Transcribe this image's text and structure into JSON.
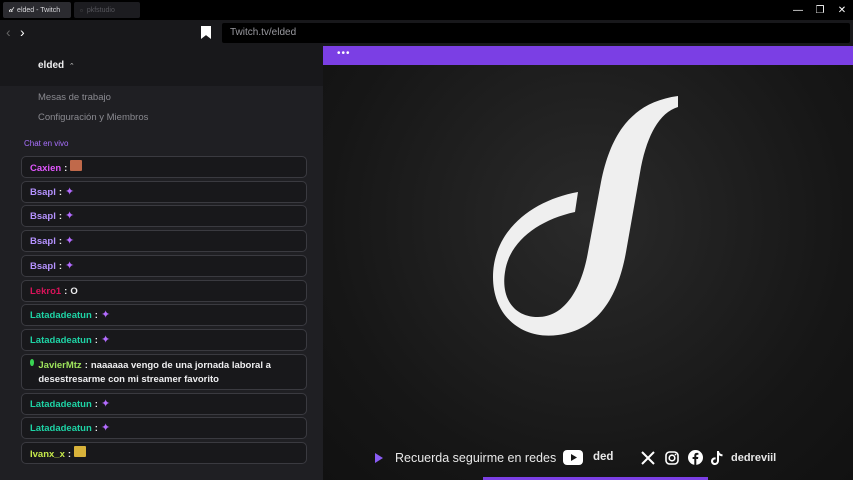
{
  "window": {
    "tabs": [
      {
        "label": "elded - Twitch",
        "active": true
      },
      {
        "label": "pkfstudio",
        "active": false
      }
    ],
    "controls": {
      "minimize": "—",
      "restore": "❐",
      "close": "✕"
    }
  },
  "nav": {
    "back": "‹",
    "forward": "›",
    "url": "Twitch.tv/elded"
  },
  "sidebar": {
    "channel": "elded",
    "channel_chevron": "⌃",
    "menu": [
      "Mesas de trabajo",
      "Configuración y Miembros"
    ],
    "section_label": "Chat en vivo"
  },
  "chat": [
    {
      "user": "Caxien",
      "color": "#e056fd",
      "text": "",
      "emote": "image-emote"
    },
    {
      "user": "Bsapl",
      "color": "#b592ff",
      "text": "",
      "emote": "purple-emote"
    },
    {
      "user": "Bsapl",
      "color": "#b592ff",
      "text": "",
      "emote": "purple-emote"
    },
    {
      "user": "Bsapl",
      "color": "#b592ff",
      "text": "",
      "emote": "purple-emote"
    },
    {
      "user": "Bsapl",
      "color": "#b592ff",
      "text": "",
      "emote": "purple-emote"
    },
    {
      "user": "Lekro1",
      "color": "#d9135a",
      "text": "O",
      "emote": ""
    },
    {
      "user": "Latadadeatun",
      "color": "#1ed3a5",
      "text": "",
      "emote": "purple-emote"
    },
    {
      "user": "Latadadeatun",
      "color": "#1ed3a5",
      "text": "",
      "emote": "purple-emote"
    },
    {
      "user": "JavierMtz",
      "color": "#9ee35c",
      "text": "naaaaaa vengo de una jornada laboral a desestresarme con mi streamer favorito",
      "emote": "",
      "badge": true
    },
    {
      "user": "Latadadeatun",
      "color": "#1ed3a5",
      "text": "",
      "emote": "purple-emote"
    },
    {
      "user": "Latadadeatun",
      "color": "#1ed3a5",
      "text": "",
      "emote": "purple-emote"
    },
    {
      "user": "Ivanx_x",
      "color": "#c6e94b",
      "text": "",
      "emote": "image-emote-2"
    }
  ],
  "stream": {
    "menu_dots": "•••",
    "footer_text": "Recuerda seguirme en redes",
    "youtube_handle": "ded",
    "social_handle": "dedreviil",
    "icons": [
      "play-icon",
      "youtube-icon",
      "x-icon",
      "instagram-icon",
      "facebook-icon",
      "tiktok-icon"
    ]
  },
  "colors": {
    "accent": "#7b3fe4",
    "sidebar_bg": "#1f1f23"
  }
}
